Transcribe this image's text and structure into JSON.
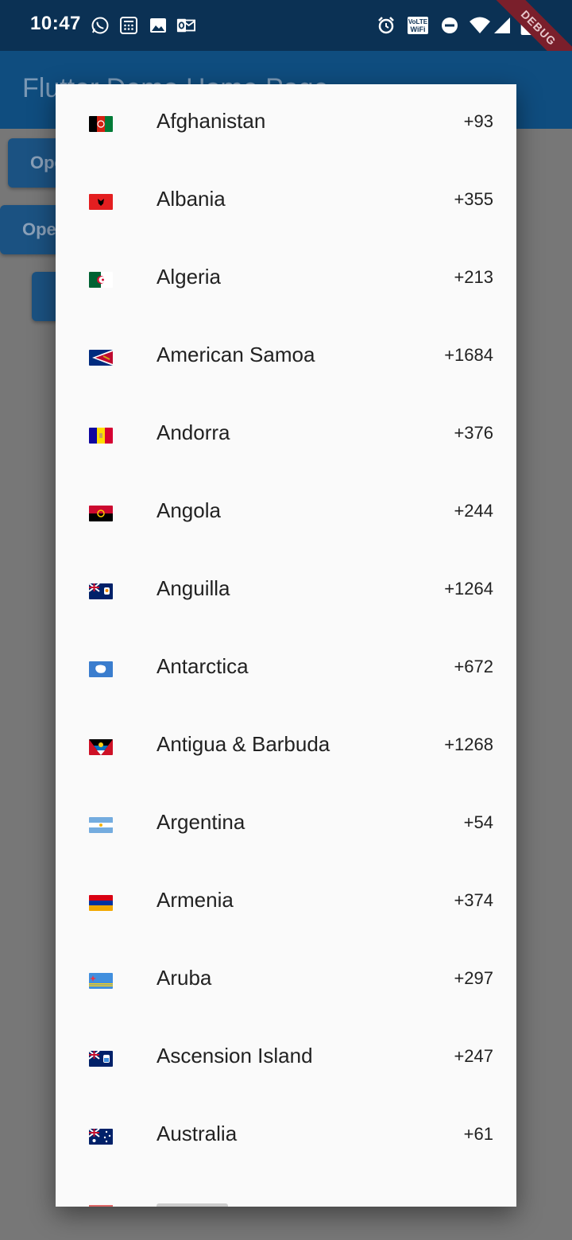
{
  "status_bar": {
    "time": "10:47",
    "left_icons": [
      "whatsapp-icon",
      "calculator-icon",
      "image-icon",
      "outlook-icon"
    ],
    "right_icons": [
      "alarm-icon",
      "volte-wifi-icon",
      "do-not-disturb-icon",
      "wifi-icon",
      "signal-icon",
      "battery-icon"
    ],
    "debug_banner": "DEBUG"
  },
  "app_bar": {
    "title": "Flutter Demo Home Page"
  },
  "background_buttons": [
    {
      "label": "Open"
    },
    {
      "label": "Open"
    },
    {
      "label": ""
    }
  ],
  "colors": {
    "status_bar": "#0b3154",
    "app_bar": "#0f4d7f",
    "scrim": "#777777",
    "dialog": "#fafafa",
    "text": "#222222"
  },
  "countries": [
    {
      "flag": "flag-afghanistan-icon",
      "name": "Afghanistan",
      "code": "+93"
    },
    {
      "flag": "flag-albania-icon",
      "name": "Albania",
      "code": "+355"
    },
    {
      "flag": "flag-algeria-icon",
      "name": "Algeria",
      "code": "+213"
    },
    {
      "flag": "flag-american-samoa-icon",
      "name": "American Samoa",
      "code": "+1684"
    },
    {
      "flag": "flag-andorra-icon",
      "name": "Andorra",
      "code": "+376"
    },
    {
      "flag": "flag-angola-icon",
      "name": "Angola",
      "code": "+244"
    },
    {
      "flag": "flag-anguilla-icon",
      "name": "Anguilla",
      "code": "+1264"
    },
    {
      "flag": "flag-antarctica-icon",
      "name": "Antarctica",
      "code": "+672"
    },
    {
      "flag": "flag-antigua-barbuda-icon",
      "name": "Antigua & Barbuda",
      "code": "+1268"
    },
    {
      "flag": "flag-argentina-icon",
      "name": "Argentina",
      "code": "+54"
    },
    {
      "flag": "flag-armenia-icon",
      "name": "Armenia",
      "code": "+374"
    },
    {
      "flag": "flag-aruba-icon",
      "name": "Aruba",
      "code": "+297"
    },
    {
      "flag": "flag-ascension-island-icon",
      "name": "Ascension Island",
      "code": "+247"
    },
    {
      "flag": "flag-australia-icon",
      "name": "Australia",
      "code": "+61"
    }
  ]
}
